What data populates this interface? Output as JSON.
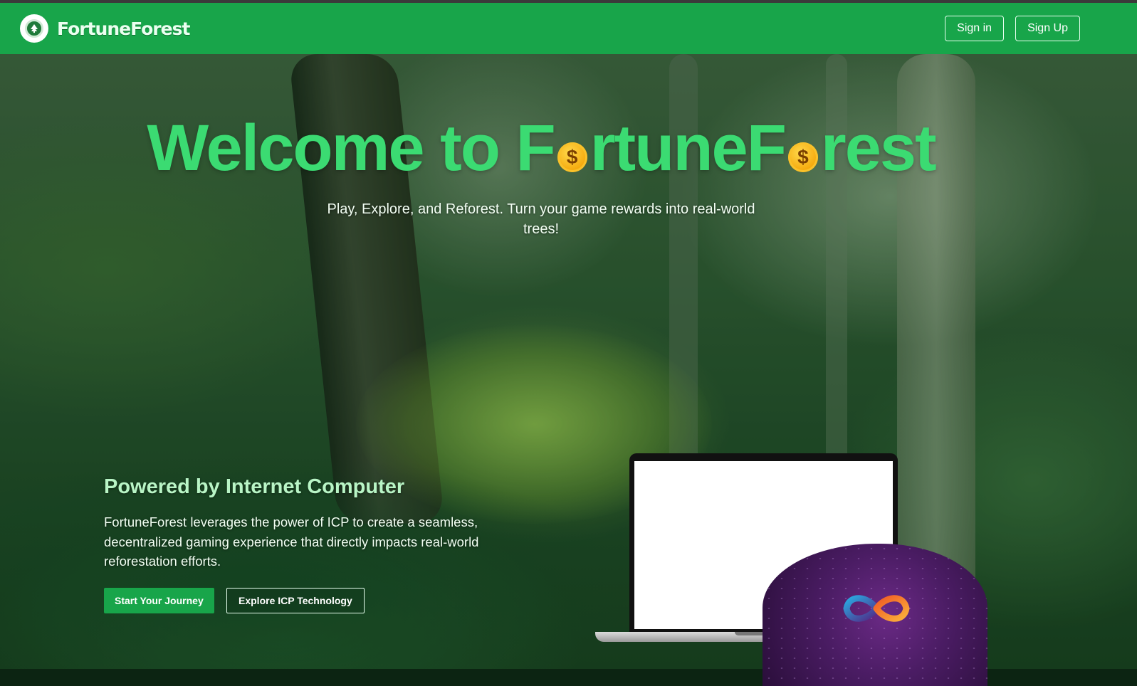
{
  "header": {
    "brand": "FortuneForest",
    "sign_in_label": "Sign in",
    "sign_up_label": "Sign Up"
  },
  "hero": {
    "title_part1": "Welcome to F",
    "title_part2": "rtuneF",
    "title_part3": "rest",
    "coin_glyph": "$",
    "subtitle": "Play, Explore, and Reforest. Turn your game rewards into real-world trees!"
  },
  "powered": {
    "title": "Powered by Internet Computer",
    "body": "FortuneForest leverages the power of ICP to create a seamless, decentralized gaming experience that directly impacts real-world reforestation efforts.",
    "primary_cta": "Start Your Journey",
    "secondary_cta": "Explore ICP Technology"
  },
  "colors": {
    "brand_green": "#18a54a",
    "title_green": "#3bdb72",
    "icp_purple": "#4a1c63"
  },
  "icons": [
    "brand-logo-icon",
    "coin-icon",
    "icp-infinity-icon"
  ]
}
